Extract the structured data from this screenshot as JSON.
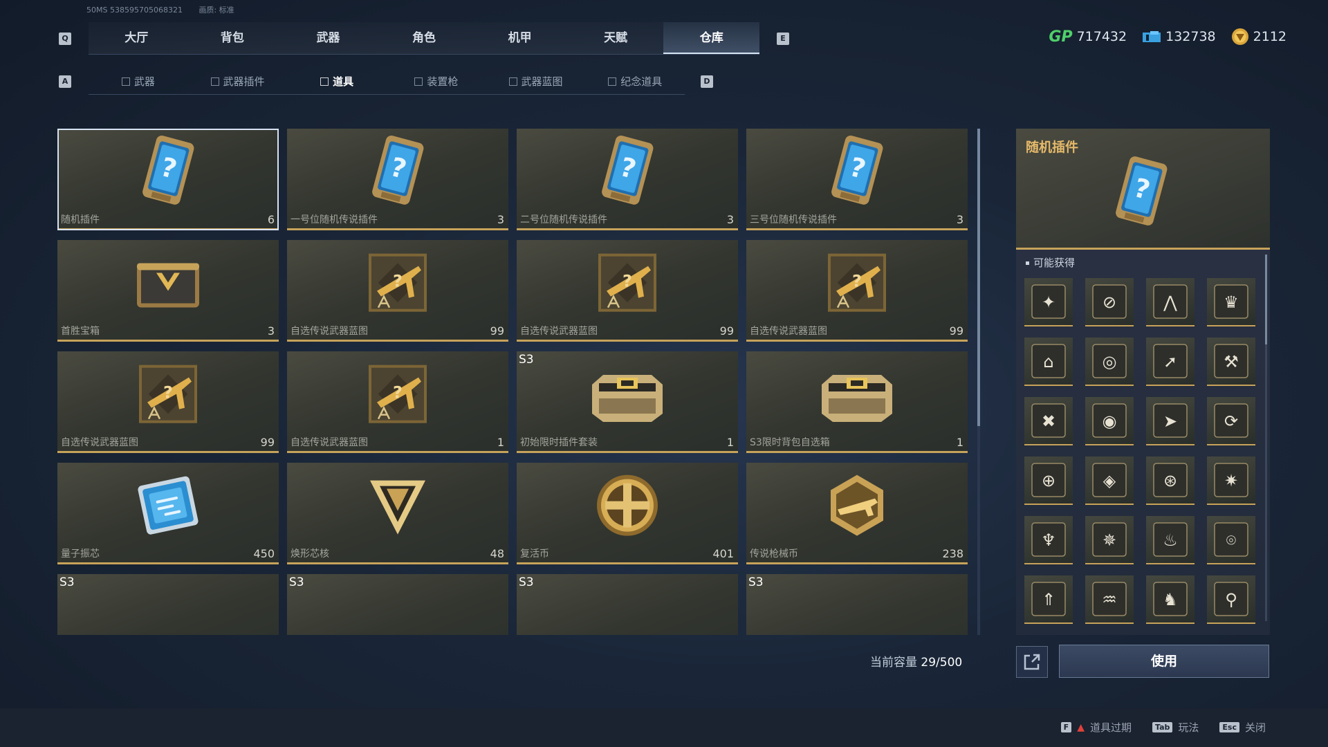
{
  "top_info": {
    "id": "50MS 538595705068321",
    "quality": "画质: 标准"
  },
  "keys": {
    "tab_left": "Q",
    "tab_right": "E",
    "sub_left": "A",
    "sub_right": "D"
  },
  "main_tabs": [
    {
      "label": "大厅",
      "active": false
    },
    {
      "label": "背包",
      "active": false
    },
    {
      "label": "武器",
      "active": false
    },
    {
      "label": "角色",
      "active": false
    },
    {
      "label": "机甲",
      "active": false
    },
    {
      "label": "天赋",
      "active": false
    },
    {
      "label": "仓库",
      "active": true
    }
  ],
  "currencies": [
    {
      "icon": "gp-icon",
      "value": "717432"
    },
    {
      "icon": "ticket-icon",
      "value": "132738"
    },
    {
      "icon": "coin-icon",
      "value": "2112"
    }
  ],
  "sub_tabs": [
    {
      "label": "武器",
      "active": false
    },
    {
      "label": "武器插件",
      "active": false
    },
    {
      "label": "道具",
      "active": true
    },
    {
      "label": "装置枪",
      "active": false
    },
    {
      "label": "武器蓝图",
      "active": false
    },
    {
      "label": "纪念道具",
      "active": false
    }
  ],
  "items": [
    {
      "name": "随机插件",
      "count": "6",
      "tag": "",
      "icon": "plugin-icon"
    },
    {
      "name": "一号位随机传说插件",
      "count": "3",
      "tag": "",
      "icon": "plugin-icon"
    },
    {
      "name": "二号位随机传说插件",
      "count": "3",
      "tag": "",
      "icon": "plugin-icon"
    },
    {
      "name": "三号位随机传说插件",
      "count": "3",
      "tag": "",
      "icon": "plugin-icon"
    },
    {
      "name": "首胜宝箱",
      "count": "3",
      "tag": "",
      "icon": "chest-icon"
    },
    {
      "name": "自选传说武器蓝图",
      "count": "99",
      "tag": "",
      "icon": "blueprint-icon"
    },
    {
      "name": "自选传说武器蓝图",
      "count": "99",
      "tag": "",
      "icon": "blueprint-icon"
    },
    {
      "name": "自选传说武器蓝图",
      "count": "99",
      "tag": "",
      "icon": "blueprint-icon"
    },
    {
      "name": "自选传说武器蓝图",
      "count": "99",
      "tag": "",
      "icon": "blueprint-icon"
    },
    {
      "name": "自选传说武器蓝图",
      "count": "1",
      "tag": "",
      "icon": "blueprint-icon"
    },
    {
      "name": "初始限时插件套装",
      "count": "1",
      "tag": "S3",
      "icon": "case-icon"
    },
    {
      "name": "S3限时背包自选箱",
      "count": "1",
      "tag": "",
      "icon": "case-icon"
    },
    {
      "name": "量子振芯",
      "count": "450",
      "tag": "",
      "icon": "chip-icon"
    },
    {
      "name": "焕形芯核",
      "count": "48",
      "tag": "",
      "icon": "core-icon"
    },
    {
      "name": "复活币",
      "count": "401",
      "tag": "",
      "icon": "revive-coin-icon"
    },
    {
      "name": "传说枪械币",
      "count": "238",
      "tag": "",
      "icon": "gun-coin-icon"
    },
    {
      "name": "",
      "count": "",
      "tag": "S3",
      "icon": "backpack-icon"
    },
    {
      "name": "",
      "count": "",
      "tag": "S3",
      "icon": "backpack-icon"
    },
    {
      "name": "",
      "count": "",
      "tag": "S3",
      "icon": "backpack-icon"
    },
    {
      "name": "",
      "count": "",
      "tag": "S3",
      "icon": "backpack-icon"
    }
  ],
  "capacity": {
    "label": "当前容量",
    "value": "29/500"
  },
  "detail": {
    "title": "随机插件",
    "possible_label": "可能获得",
    "use_button": "使用"
  },
  "hints": [
    {
      "key": "F",
      "label": "道具过期",
      "warning": true
    },
    {
      "key": "Tab",
      "label": "玩法",
      "warning": false
    },
    {
      "key": "Esc",
      "label": "关闭",
      "warning": false
    }
  ],
  "colors": {
    "gold": "#c7a35a",
    "title_gold": "#e4b96a",
    "blue": "#3aa0e0"
  }
}
